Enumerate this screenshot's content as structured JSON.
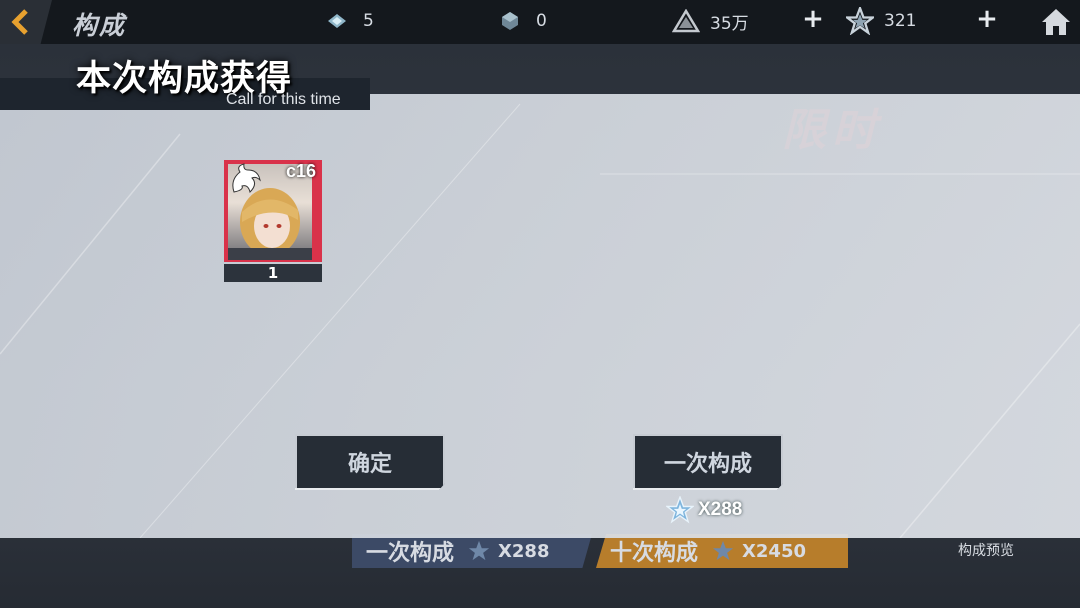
{
  "header": {
    "title": "构成",
    "resources": [
      {
        "icon": "crystal-icon",
        "value": "5"
      },
      {
        "icon": "cube-ticket-icon",
        "value": "0"
      },
      {
        "icon": "coin-triangle-icon",
        "value": "35万"
      },
      {
        "icon": "star-crystal-icon",
        "value": "321"
      }
    ]
  },
  "background": {
    "promo_text": "限时",
    "bottom_buttons": [
      {
        "label": "一次构成",
        "cost": "X288"
      },
      {
        "label": "十次构成",
        "cost": "X2450"
      }
    ],
    "preview_label": "构成预览"
  },
  "result": {
    "title": "本次构成获得",
    "subtitle": "Call for this time",
    "item": {
      "code": "c16",
      "count": "1",
      "frame_color": "#d9324a"
    }
  },
  "actions": {
    "confirm_label": "确定",
    "again_label": "一次构成",
    "again_cost": "X288"
  },
  "colors": {
    "accent_gold": "#b77d2b",
    "panel_bg": "#d4d9e0",
    "button_dark": "#262d36"
  }
}
